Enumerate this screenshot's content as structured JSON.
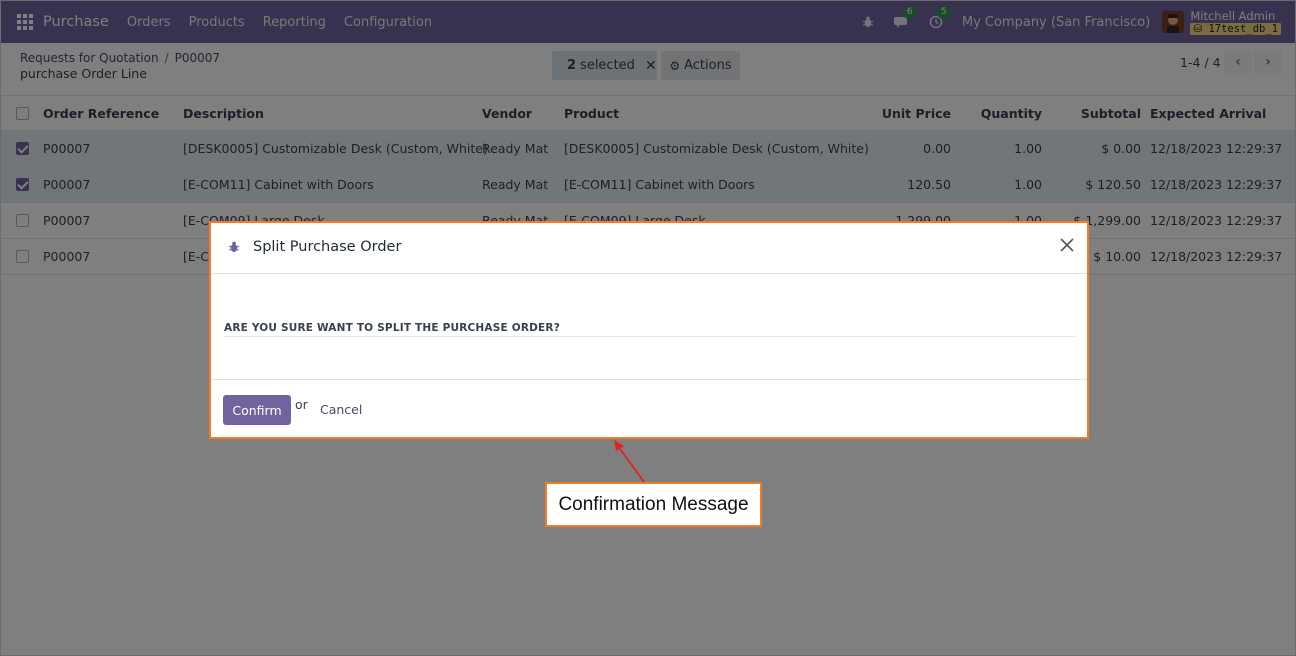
{
  "navbar": {
    "app_name": "Purchase",
    "menu": [
      "Orders",
      "Products",
      "Reporting",
      "Configuration"
    ],
    "messages_count": "6",
    "activities_count": "5",
    "company": "My Company (San Francisco)",
    "user_name": "Mitchell Admin",
    "database": "17test_db_1"
  },
  "control_panel": {
    "breadcrumb_root": "Requests for Quotation",
    "breadcrumb_separator": "/",
    "breadcrumb_current": "P00007",
    "subtitle": "purchase Order Line",
    "selected_count": "2",
    "selected_label": "selected",
    "actions_label": "Actions",
    "pager": "1-4 / 4"
  },
  "table": {
    "columns": [
      "Order Reference",
      "Description",
      "Vendor",
      "Product",
      "Unit Price",
      "Quantity",
      "Subtotal",
      "Expected Arrival"
    ],
    "rows": [
      {
        "ref": "P00007",
        "description": "[DESK0005] Customizable Desk (Custom, White)",
        "vendor": "Ready Mat",
        "product": "[DESK0005] Customizable Desk (Custom, White)",
        "unit_price": "0.00",
        "quantity": "1.00",
        "subtotal": "$ 0.00",
        "arrival": "12/18/2023 12:29:37",
        "selected": true
      },
      {
        "ref": "P00007",
        "description": "[E-COM11] Cabinet with Doors",
        "vendor": "Ready Mat",
        "product": "[E-COM11] Cabinet with Doors",
        "unit_price": "120.50",
        "quantity": "1.00",
        "subtotal": "$ 120.50",
        "arrival": "12/18/2023 12:29:37",
        "selected": true
      },
      {
        "ref": "P00007",
        "description": "[E-COM09] Large Desk",
        "vendor": "Ready Mat",
        "product": "[E-COM09] Large Desk",
        "unit_price": "1,299.00",
        "quantity": "1.00",
        "subtotal": "$ 1,299.00",
        "arrival": "12/18/2023 12:29:37",
        "selected": false
      },
      {
        "ref": "P00007",
        "description": "[E-COM",
        "vendor": "",
        "product": "",
        "unit_price": "",
        "quantity": "",
        "subtotal": "$ 10.00",
        "arrival": "12/18/2023 12:29:37",
        "selected": false
      }
    ]
  },
  "modal": {
    "title": "Split Purchase Order",
    "question": "ARE YOU SURE WANT TO SPLIT THE PURCHASE ORDER?",
    "confirm_label": "Confirm",
    "or_label": "or",
    "cancel_label": "Cancel"
  },
  "annotation": {
    "label": "Confirmation Message",
    "color": "#f47b20"
  },
  "colors": {
    "brand": "#71639e",
    "selected_row": "#e3eff2",
    "badge": "#2f9a4d"
  }
}
